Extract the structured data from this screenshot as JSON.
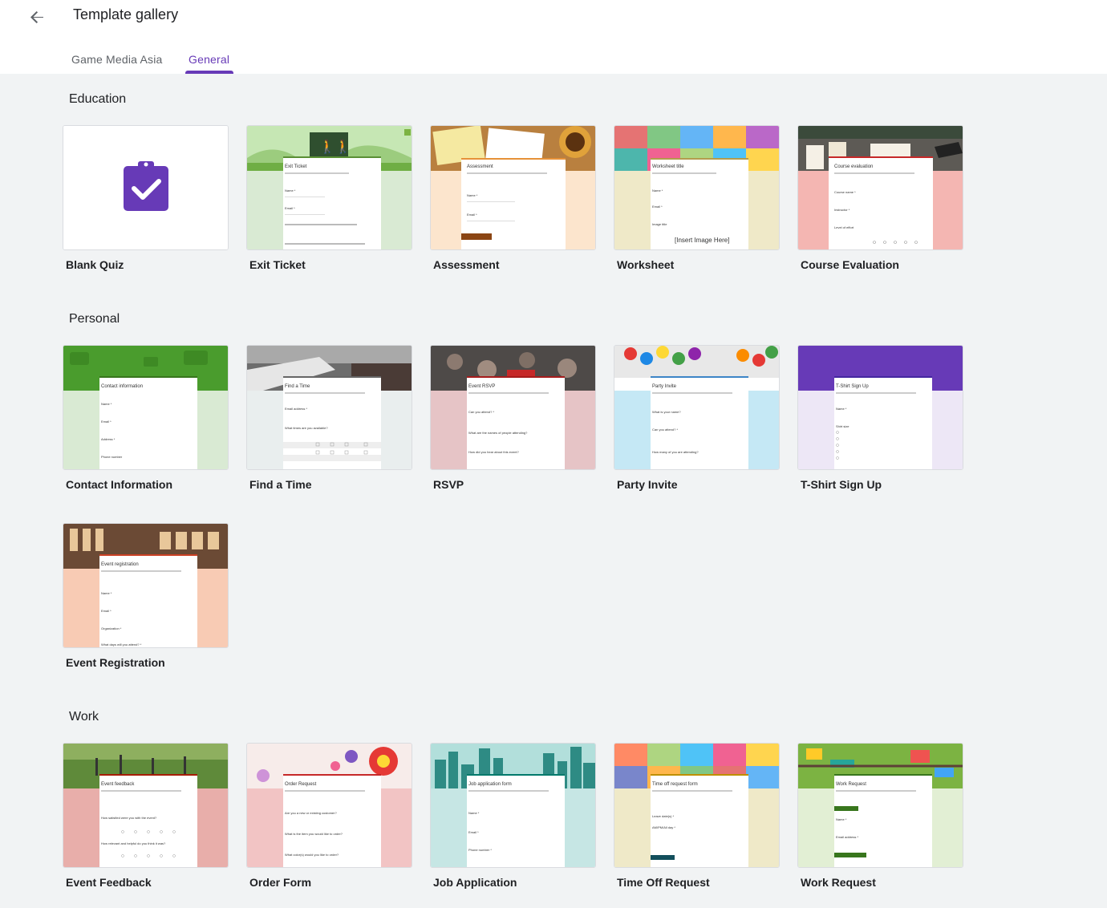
{
  "header": {
    "title": "Template gallery",
    "back_icon": "arrow-back-icon"
  },
  "tabs": [
    {
      "label": "Game Media Asia",
      "active": false
    },
    {
      "label": "General",
      "active": true
    }
  ],
  "accent_color": "#673ab7",
  "sections": {
    "education": {
      "title": "Education",
      "templates": [
        {
          "name": "Blank Quiz",
          "form_title": ""
        },
        {
          "name": "Exit Ticket",
          "form_title": "Exit Ticket"
        },
        {
          "name": "Assessment",
          "form_title": "Assessment"
        },
        {
          "name": "Worksheet",
          "form_title": "Worksheet title"
        },
        {
          "name": "Course Evaluation",
          "form_title": "Course evaluation"
        }
      ]
    },
    "personal": {
      "title": "Personal",
      "templates": [
        {
          "name": "Contact Information",
          "form_title": "Contact information"
        },
        {
          "name": "Find a Time",
          "form_title": "Find a Time"
        },
        {
          "name": "RSVP",
          "form_title": "Event RSVP"
        },
        {
          "name": "Party Invite",
          "form_title": "Party Invite"
        },
        {
          "name": "T-Shirt Sign Up",
          "form_title": "T-Shirt Sign Up"
        },
        {
          "name": "Event Registration",
          "form_title": "Event registration"
        }
      ]
    },
    "work": {
      "title": "Work",
      "templates": [
        {
          "name": "Event Feedback",
          "form_title": "Event feedback"
        },
        {
          "name": "Order Form",
          "form_title": "Order Request"
        },
        {
          "name": "Job Application",
          "form_title": "Job application form"
        },
        {
          "name": "Time Off Request",
          "form_title": "Time off request form"
        },
        {
          "name": "Work Request",
          "form_title": "Work Request"
        }
      ]
    }
  },
  "preview_text": {
    "name_field": "Name *",
    "email_field": "Email *",
    "worksheet_image": "[Insert Image Here]"
  },
  "colors": {
    "exit_ticket": "#d9ead3",
    "assessment": "#fce5cd",
    "worksheet": "#efe9c8",
    "course_eval": "#f4b6b2",
    "contact": "#d9ead3",
    "find_time": "#e9eeee",
    "rsvp": "#e6c4c6",
    "party": "#c5e8f5",
    "tshirt": "#ede7f6",
    "event_reg": "#f8cbb4",
    "event_feedback": "#e8aeaa",
    "order": "#f2c4c4",
    "job": "#c6e6e4",
    "time_off": "#efe9c8",
    "work_request": "#e2efd4"
  }
}
